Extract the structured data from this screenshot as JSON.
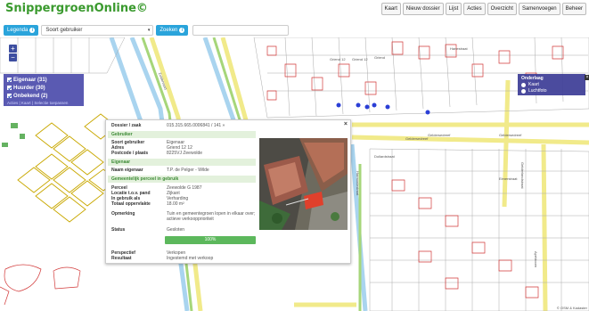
{
  "app": {
    "title": "SnippergroenOnline©"
  },
  "nav": {
    "items": [
      "Kaart",
      "Nieuw dossier",
      "Lijst",
      "Acties",
      "Overzicht",
      "Samenvoegen",
      "Beheer"
    ]
  },
  "search": {
    "legend_label": "Legenda",
    "select_value": "Soort gebruiker",
    "search_label": "Zoeken"
  },
  "legend": {
    "items": [
      {
        "label": "Eigenaar (31)"
      },
      {
        "label": "Huurder (30)"
      },
      {
        "label": "Onbekend (2)"
      }
    ],
    "links": "Acties | Kaart | Selectie toepassen"
  },
  "baselayer": {
    "title": "Onderlaag",
    "options": [
      "Kaart",
      "Luchtfoto"
    ]
  },
  "map": {
    "street_labels": [
      "Griend 12",
      "Griend 12",
      "Griend",
      "Geldersedreef",
      "Geldersedreef",
      "Geldersedreef",
      "Gelderlandstraat",
      "Zuidervaart",
      "Brederodestraat",
      "Dillenburgstraat",
      "Dollardstraat",
      "Harmoniestraat",
      "Elmerstraat",
      "Apeldoorn",
      "Hanestraat"
    ],
    "attribution": "© OSM & Kadaster"
  },
  "popup": {
    "dossier_label": "Dossier / zaak",
    "dossier_value": "015.315.665.0006841 / 141 »",
    "sections": {
      "gebruiker": "Gebruiker",
      "eigenaar": "Eigenaar",
      "perceel": "Gemeentelijk perceel in gebruik"
    },
    "gebruiker": [
      {
        "k": "Soort gebruiker",
        "v": "Eigenaar"
      },
      {
        "k": "Adres",
        "v": "Griend 12 12"
      },
      {
        "k": "Postcode / plaats",
        "v": "8225VJ Zeewolde"
      }
    ],
    "eigenaar": [
      {
        "k": "Naam eigenaar",
        "v": "T.P. de Pelger - Wilde"
      }
    ],
    "perceel": [
      {
        "k": "Perceel",
        "v": "Zeewolde G 1987"
      },
      {
        "k": "Locatie t.o.v. pand",
        "v": "Zijkant"
      },
      {
        "k": "In gebruik als",
        "v": "Verharding"
      },
      {
        "k": "Totaal oppervlakte",
        "v": "18.00 m²"
      }
    ],
    "opmerking_label": "Opmerking",
    "opmerking_value": "Tuin en gemeentegroen lopen in elkaar over; actieve verkoopprioriteit",
    "status_label": "Status",
    "status_value": "Gesloten",
    "progress_value": 100,
    "progress_text": "100%",
    "perspectief_label": "Perspectief",
    "perspectief_value": "Verkopen",
    "resultaat_label": "Resultaat",
    "resultaat_value": "Ingestemd met verkoop"
  },
  "colors": {
    "brand": "#3a9a2e",
    "parcel_red": "#d23a3a",
    "road_yellow": "#f1ea8a",
    "water_blue": "#a9d4ef",
    "legend_bg": "#4848aa"
  }
}
